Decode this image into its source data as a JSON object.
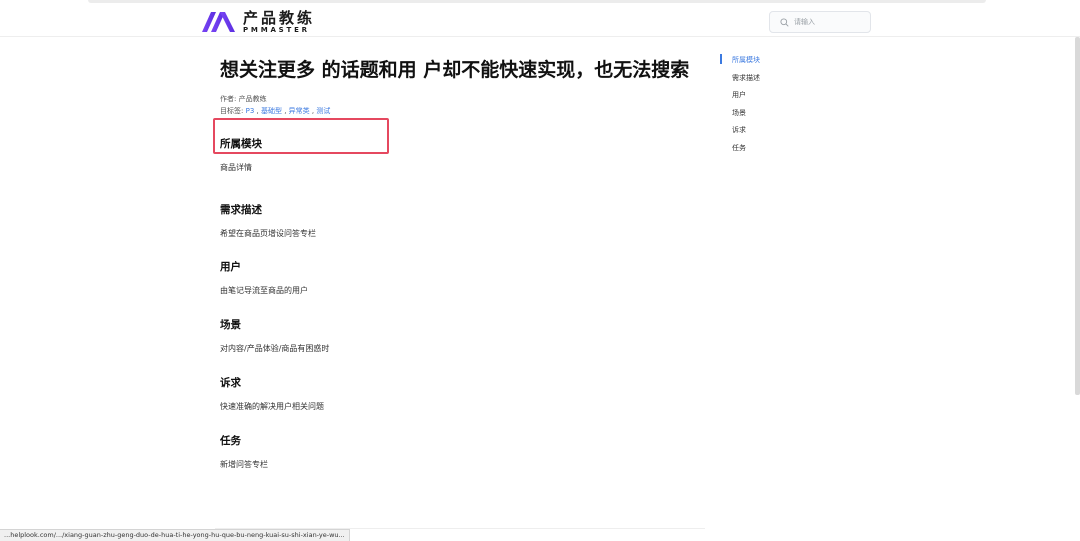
{
  "header": {
    "logo_cn": "产品教练",
    "logo_en": "PMMASTER",
    "search_placeholder": "请输入",
    "brand_color": "#6b3df0",
    "icons": [
      "pmmaster-logo-icon",
      "search-icon"
    ]
  },
  "article": {
    "title": "想关注更多 的话题和用 户却不能快速实现，也无法搜索",
    "author_label": "作者: ",
    "author": "产品教练",
    "tags_label": "目标签: ",
    "tags": [
      "P3",
      "基础型",
      "异常类",
      "测试"
    ],
    "sections": [
      {
        "heading": "所属模块",
        "body": "商品详情"
      },
      {
        "heading": "需求描述",
        "body": "希望在商品页增设问答专栏"
      },
      {
        "heading": "用户",
        "body": "由笔记导流至商品的用户"
      },
      {
        "heading": "场景",
        "body": "对内容/产品体验/商品有困惑时"
      },
      {
        "heading": "诉求",
        "body": "快速准确的解决用户相关问题"
      },
      {
        "heading": "任务",
        "body": "新增问答专栏"
      }
    ]
  },
  "toc": {
    "items": [
      "所属模块",
      "需求描述",
      "用户",
      "场景",
      "诉求",
      "任务"
    ],
    "active_index": 0,
    "accent_color": "#3c7ae0"
  },
  "statusbar": {
    "url": "...helplook.com/.../xiang-guan-zhu-geng-duo-de-hua-ti-he-yong-hu-que-bu-neng-kuai-su-shi-xian-ye-wu..."
  },
  "highlight_color": "#e5485f"
}
